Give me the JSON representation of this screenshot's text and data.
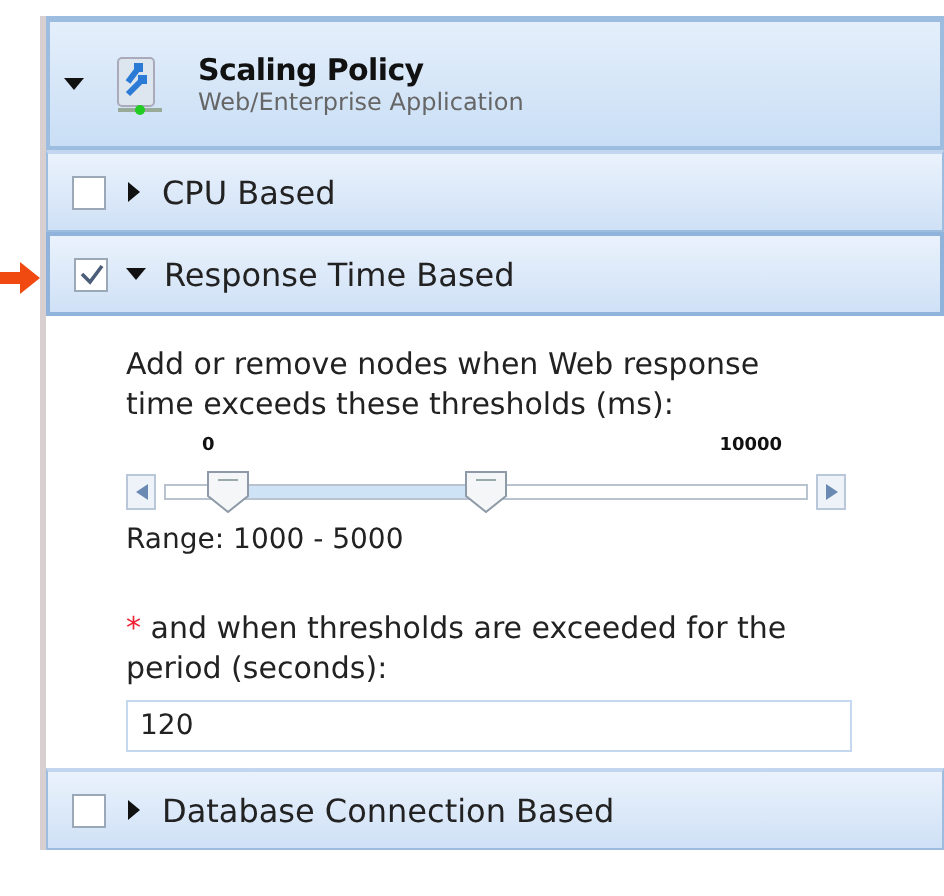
{
  "header": {
    "title": "Scaling Policy",
    "subtitle": "Web/Enterprise Application",
    "expanded": true
  },
  "sections": [
    {
      "label": "CPU Based",
      "checked": false,
      "expanded": false
    },
    {
      "label": "Response Time Based",
      "checked": true,
      "expanded": true,
      "highlighted": true,
      "body": {
        "description": "Add or remove nodes when Web response time exceeds these thresholds (ms):",
        "slider": {
          "min_label": "0",
          "max_label": "10000",
          "thumbs": [
            {
              "level": 0.1
            },
            {
              "level": 0.5
            }
          ]
        },
        "range": "Range: 1000  -  5000",
        "period_label": {
          "required_mark": "*",
          "text": " and when thresholds are exceeded for the period (seconds):"
        },
        "period_value": "120"
      }
    },
    {
      "label": "Database Connection Based",
      "checked": false,
      "expanded": false
    }
  ]
}
